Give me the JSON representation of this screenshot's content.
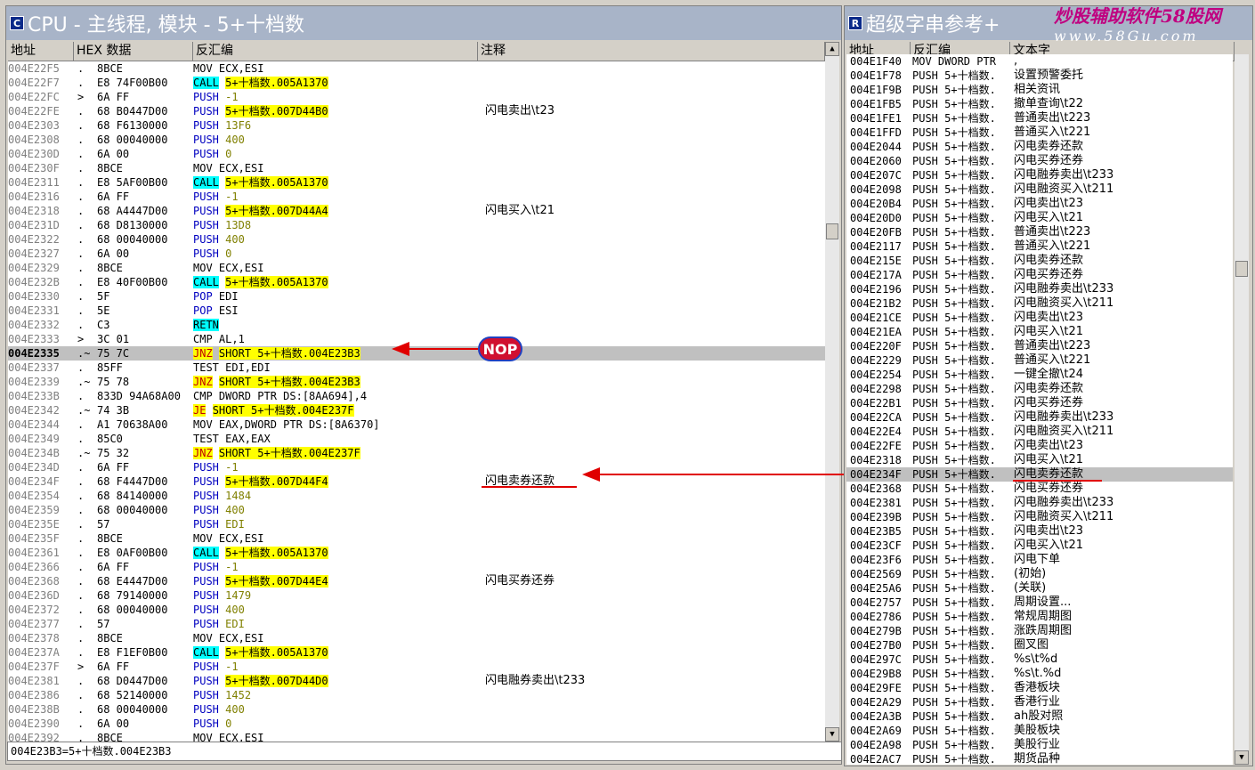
{
  "cpu": {
    "title": "CPU - 主线程, 模块 - 5+十档数",
    "icon": "C",
    "headers": {
      "addr": "地址",
      "hex": "HEX 数据",
      "disasm": "反汇编",
      "comment": "注释"
    },
    "rows": [
      {
        "addr": "004E22F5",
        "m": ".",
        "hex": "8BCE",
        "op": "MOV ECX,ESI",
        "t": "n"
      },
      {
        "addr": "004E22F7",
        "m": ".",
        "hex": "E8 74F00B00",
        "op": "CALL",
        "arg": "5+十档数.005A1370",
        "t": "call"
      },
      {
        "addr": "004E22FC",
        "m": ">",
        "hex": "6A FF",
        "op": "PUSH",
        "arg": "-1",
        "t": "push"
      },
      {
        "addr": "004E22FE",
        "m": ".",
        "hex": "68 B0447D00",
        "op": "PUSH",
        "arg": "5+十档数.007D44B0",
        "t": "pusht",
        "c": "闪电卖出\\t23"
      },
      {
        "addr": "004E2303",
        "m": ".",
        "hex": "68 F6130000",
        "op": "PUSH",
        "arg": "13F6",
        "t": "push"
      },
      {
        "addr": "004E2308",
        "m": ".",
        "hex": "68 00040000",
        "op": "PUSH",
        "arg": "400",
        "t": "push"
      },
      {
        "addr": "004E230D",
        "m": ".",
        "hex": "6A 00",
        "op": "PUSH",
        "arg": "0",
        "t": "push"
      },
      {
        "addr": "004E230F",
        "m": ".",
        "hex": "8BCE",
        "op": "MOV ECX,ESI",
        "t": "n"
      },
      {
        "addr": "004E2311",
        "m": ".",
        "hex": "E8 5AF00B00",
        "op": "CALL",
        "arg": "5+十档数.005A1370",
        "t": "call"
      },
      {
        "addr": "004E2316",
        "m": ".",
        "hex": "6A FF",
        "op": "PUSH",
        "arg": "-1",
        "t": "push"
      },
      {
        "addr": "004E2318",
        "m": ".",
        "hex": "68 A4447D00",
        "op": "PUSH",
        "arg": "5+十档数.007D44A4",
        "t": "pusht",
        "c": "闪电买入\\t21"
      },
      {
        "addr": "004E231D",
        "m": ".",
        "hex": "68 D8130000",
        "op": "PUSH",
        "arg": "13D8",
        "t": "push"
      },
      {
        "addr": "004E2322",
        "m": ".",
        "hex": "68 00040000",
        "op": "PUSH",
        "arg": "400",
        "t": "push"
      },
      {
        "addr": "004E2327",
        "m": ".",
        "hex": "6A 00",
        "op": "PUSH",
        "arg": "0",
        "t": "push"
      },
      {
        "addr": "004E2329",
        "m": ".",
        "hex": "8BCE",
        "op": "MOV ECX,ESI",
        "t": "n"
      },
      {
        "addr": "004E232B",
        "m": ".",
        "hex": "E8 40F00B00",
        "op": "CALL",
        "arg": "5+十档数.005A1370",
        "t": "call"
      },
      {
        "addr": "004E2330",
        "m": ".",
        "hex": "5F",
        "op": "POP",
        "arg": "EDI",
        "t": "pop"
      },
      {
        "addr": "004E2331",
        "m": ".",
        "hex": "5E",
        "op": "POP",
        "arg": "ESI",
        "t": "pop"
      },
      {
        "addr": "004E2332",
        "m": ".",
        "hex": "C3",
        "op": "RETN",
        "t": "retn"
      },
      {
        "addr": "004E2333",
        "m": ">",
        "hex": "3C 01",
        "op": "CMP AL,1",
        "t": "n"
      },
      {
        "addr": "004E2335",
        "m": ".~",
        "hex": "75 7C",
        "op": "JNZ",
        "arg": "SHORT 5+十档数.004E23B3",
        "t": "jmp",
        "sel": true
      },
      {
        "addr": "004E2337",
        "m": ".",
        "hex": "85FF",
        "op": "TEST EDI,EDI",
        "t": "n"
      },
      {
        "addr": "004E2339",
        "m": ".~",
        "hex": "75 78",
        "op": "JNZ",
        "arg": "SHORT 5+十档数.004E23B3",
        "t": "jmp"
      },
      {
        "addr": "004E233B",
        "m": ".",
        "hex": "833D 94A68A00",
        "op": "CMP DWORD PTR DS:[8AA694],4",
        "t": "n"
      },
      {
        "addr": "004E2342",
        "m": ".~",
        "hex": "74 3B",
        "op": "JE",
        "arg": "SHORT 5+十档数.004E237F",
        "t": "jmp"
      },
      {
        "addr": "004E2344",
        "m": ".",
        "hex": "A1 70638A00",
        "op": "MOV EAX,DWORD PTR DS:[8A6370]",
        "t": "n"
      },
      {
        "addr": "004E2349",
        "m": ".",
        "hex": "85C0",
        "op": "TEST EAX,EAX",
        "t": "n"
      },
      {
        "addr": "004E234B",
        "m": ".~",
        "hex": "75 32",
        "op": "JNZ",
        "arg": "SHORT 5+十档数.004E237F",
        "t": "jmp"
      },
      {
        "addr": "004E234D",
        "m": ".",
        "hex": "6A FF",
        "op": "PUSH",
        "arg": "-1",
        "t": "push"
      },
      {
        "addr": "004E234F",
        "m": ".",
        "hex": "68 F4447D00",
        "op": "PUSH",
        "arg": "5+十档数.007D44F4",
        "t": "pusht",
        "c": "闪电卖券还款"
      },
      {
        "addr": "004E2354",
        "m": ".",
        "hex": "68 84140000",
        "op": "PUSH",
        "arg": "1484",
        "t": "push"
      },
      {
        "addr": "004E2359",
        "m": ".",
        "hex": "68 00040000",
        "op": "PUSH",
        "arg": "400",
        "t": "push"
      },
      {
        "addr": "004E235E",
        "m": ".",
        "hex": "57",
        "op": "PUSH",
        "arg": "EDI",
        "t": "push"
      },
      {
        "addr": "004E235F",
        "m": ".",
        "hex": "8BCE",
        "op": "MOV ECX,ESI",
        "t": "n"
      },
      {
        "addr": "004E2361",
        "m": ".",
        "hex": "E8 0AF00B00",
        "op": "CALL",
        "arg": "5+十档数.005A1370",
        "t": "call"
      },
      {
        "addr": "004E2366",
        "m": ".",
        "hex": "6A FF",
        "op": "PUSH",
        "arg": "-1",
        "t": "push"
      },
      {
        "addr": "004E2368",
        "m": ".",
        "hex": "68 E4447D00",
        "op": "PUSH",
        "arg": "5+十档数.007D44E4",
        "t": "pusht",
        "c": "闪电买券还券"
      },
      {
        "addr": "004E236D",
        "m": ".",
        "hex": "68 79140000",
        "op": "PUSH",
        "arg": "1479",
        "t": "push"
      },
      {
        "addr": "004E2372",
        "m": ".",
        "hex": "68 00040000",
        "op": "PUSH",
        "arg": "400",
        "t": "push"
      },
      {
        "addr": "004E2377",
        "m": ".",
        "hex": "57",
        "op": "PUSH",
        "arg": "EDI",
        "t": "push"
      },
      {
        "addr": "004E2378",
        "m": ".",
        "hex": "8BCE",
        "op": "MOV ECX,ESI",
        "t": "n"
      },
      {
        "addr": "004E237A",
        "m": ".",
        "hex": "E8 F1EF0B00",
        "op": "CALL",
        "arg": "5+十档数.005A1370",
        "t": "call"
      },
      {
        "addr": "004E237F",
        "m": ">",
        "hex": "6A FF",
        "op": "PUSH",
        "arg": "-1",
        "t": "push"
      },
      {
        "addr": "004E2381",
        "m": ".",
        "hex": "68 D0447D00",
        "op": "PUSH",
        "arg": "5+十档数.007D44D0",
        "t": "pusht",
        "c": "闪电融券卖出\\t233"
      },
      {
        "addr": "004E2386",
        "m": ".",
        "hex": "68 52140000",
        "op": "PUSH",
        "arg": "1452",
        "t": "push"
      },
      {
        "addr": "004E238B",
        "m": ".",
        "hex": "68 00040000",
        "op": "PUSH",
        "arg": "400",
        "t": "push"
      },
      {
        "addr": "004E2390",
        "m": ".",
        "hex": "6A 00",
        "op": "PUSH",
        "arg": "0",
        "t": "push"
      },
      {
        "addr": "004E2392",
        "m": ".",
        "hex": "8BCE",
        "op": "MOV ECX,ESI",
        "t": "n"
      }
    ],
    "status": "004E23B3=5+十档数.004E23B3",
    "nop_label": "NOP"
  },
  "strings": {
    "title": "超级字串参考+",
    "icon": "R",
    "headers": {
      "addr": "地址",
      "disasm": "反汇编",
      "text": "文本字"
    },
    "rows": [
      {
        "addr": "004E1F40",
        "op": "MOV DWORD PTR",
        "txt": ","
      },
      {
        "addr": "004E1F78",
        "op": "PUSH 5+十档数.",
        "txt": "设置预警委托"
      },
      {
        "addr": "004E1F9B",
        "op": "PUSH 5+十档数.",
        "txt": "相关资讯"
      },
      {
        "addr": "004E1FB5",
        "op": "PUSH 5+十档数.",
        "txt": "撤单查询\\t22"
      },
      {
        "addr": "004E1FE1",
        "op": "PUSH 5+十档数.",
        "txt": "普通卖出\\t223"
      },
      {
        "addr": "004E1FFD",
        "op": "PUSH 5+十档数.",
        "txt": "普通买入\\t221"
      },
      {
        "addr": "004E2044",
        "op": "PUSH 5+十档数.",
        "txt": "闪电卖券还款"
      },
      {
        "addr": "004E2060",
        "op": "PUSH 5+十档数.",
        "txt": "闪电买券还券"
      },
      {
        "addr": "004E207C",
        "op": "PUSH 5+十档数.",
        "txt": "闪电融券卖出\\t233"
      },
      {
        "addr": "004E2098",
        "op": "PUSH 5+十档数.",
        "txt": "闪电融资买入\\t211"
      },
      {
        "addr": "004E20B4",
        "op": "PUSH 5+十档数.",
        "txt": "闪电卖出\\t23"
      },
      {
        "addr": "004E20D0",
        "op": "PUSH 5+十档数.",
        "txt": "闪电买入\\t21"
      },
      {
        "addr": "004E20FB",
        "op": "PUSH 5+十档数.",
        "txt": "普通卖出\\t223"
      },
      {
        "addr": "004E2117",
        "op": "PUSH 5+十档数.",
        "txt": "普通买入\\t221"
      },
      {
        "addr": "004E215E",
        "op": "PUSH 5+十档数.",
        "txt": "闪电卖券还款"
      },
      {
        "addr": "004E217A",
        "op": "PUSH 5+十档数.",
        "txt": "闪电买券还券"
      },
      {
        "addr": "004E2196",
        "op": "PUSH 5+十档数.",
        "txt": "闪电融券卖出\\t233"
      },
      {
        "addr": "004E21B2",
        "op": "PUSH 5+十档数.",
        "txt": "闪电融资买入\\t211"
      },
      {
        "addr": "004E21CE",
        "op": "PUSH 5+十档数.",
        "txt": "闪电卖出\\t23"
      },
      {
        "addr": "004E21EA",
        "op": "PUSH 5+十档数.",
        "txt": "闪电买入\\t21"
      },
      {
        "addr": "004E220F",
        "op": "PUSH 5+十档数.",
        "txt": "普通卖出\\t223"
      },
      {
        "addr": "004E2229",
        "op": "PUSH 5+十档数.",
        "txt": "普通买入\\t221"
      },
      {
        "addr": "004E2254",
        "op": "PUSH 5+十档数.",
        "txt": "一键全撤\\t24"
      },
      {
        "addr": "004E2298",
        "op": "PUSH 5+十档数.",
        "txt": "闪电卖券还款"
      },
      {
        "addr": "004E22B1",
        "op": "PUSH 5+十档数.",
        "txt": "闪电买券还券"
      },
      {
        "addr": "004E22CA",
        "op": "PUSH 5+十档数.",
        "txt": "闪电融券卖出\\t233"
      },
      {
        "addr": "004E22E4",
        "op": "PUSH 5+十档数.",
        "txt": "闪电融资买入\\t211"
      },
      {
        "addr": "004E22FE",
        "op": "PUSH 5+十档数.",
        "txt": "闪电卖出\\t23"
      },
      {
        "addr": "004E2318",
        "op": "PUSH 5+十档数.",
        "txt": "闪电买入\\t21"
      },
      {
        "addr": "004E234F",
        "op": "PUSH 5+十档数.",
        "txt": "闪电卖券还款",
        "sel": true
      },
      {
        "addr": "004E2368",
        "op": "PUSH 5+十档数.",
        "txt": "闪电买券还券"
      },
      {
        "addr": "004E2381",
        "op": "PUSH 5+十档数.",
        "txt": "闪电融券卖出\\t233"
      },
      {
        "addr": "004E239B",
        "op": "PUSH 5+十档数.",
        "txt": "闪电融资买入\\t211"
      },
      {
        "addr": "004E23B5",
        "op": "PUSH 5+十档数.",
        "txt": "闪电卖出\\t23"
      },
      {
        "addr": "004E23CF",
        "op": "PUSH 5+十档数.",
        "txt": "闪电买入\\t21"
      },
      {
        "addr": "004E23F6",
        "op": "PUSH 5+十档数.",
        "txt": "闪电下单"
      },
      {
        "addr": "004E2569",
        "op": "PUSH 5+十档数.",
        "txt": "(初始)"
      },
      {
        "addr": "004E25A6",
        "op": "PUSH 5+十档数.",
        "txt": "(关联)"
      },
      {
        "addr": "004E2757",
        "op": "PUSH 5+十档数.",
        "txt": "周期设置..."
      },
      {
        "addr": "004E2786",
        "op": "PUSH 5+十档数.",
        "txt": "常规周期图"
      },
      {
        "addr": "004E279B",
        "op": "PUSH 5+十档数.",
        "txt": "涨跌周期图"
      },
      {
        "addr": "004E27B0",
        "op": "PUSH 5+十档数.",
        "txt": "圈叉图"
      },
      {
        "addr": "004E297C",
        "op": "PUSH 5+十档数.",
        "txt": "%s\\t%d"
      },
      {
        "addr": "004E29B8",
        "op": "PUSH 5+十档数.",
        "txt": "%s\\t.%d"
      },
      {
        "addr": "004E29FE",
        "op": "PUSH 5+十档数.",
        "txt": "香港板块"
      },
      {
        "addr": "004E2A29",
        "op": "PUSH 5+十档数.",
        "txt": "香港行业"
      },
      {
        "addr": "004E2A3B",
        "op": "PUSH 5+十档数.",
        "txt": "ah股对照"
      },
      {
        "addr": "004E2A69",
        "op": "PUSH 5+十档数.",
        "txt": "美股板块"
      },
      {
        "addr": "004E2A98",
        "op": "PUSH 5+十档数.",
        "txt": "美股行业"
      },
      {
        "addr": "004E2AC7",
        "op": "PUSH 5+十档数.",
        "txt": "期货品种"
      }
    ]
  },
  "watermark": {
    "line1": "炒股辅助软件58股网",
    "line2": "www.58Gu.com"
  },
  "colors": {
    "title_bg": "#a8b4c8",
    "highlight": "#ffff00",
    "call_bg": "#00ffff",
    "jump_text": "#c00000",
    "arrow": "#e00000",
    "nop_badge": "#d01030"
  }
}
